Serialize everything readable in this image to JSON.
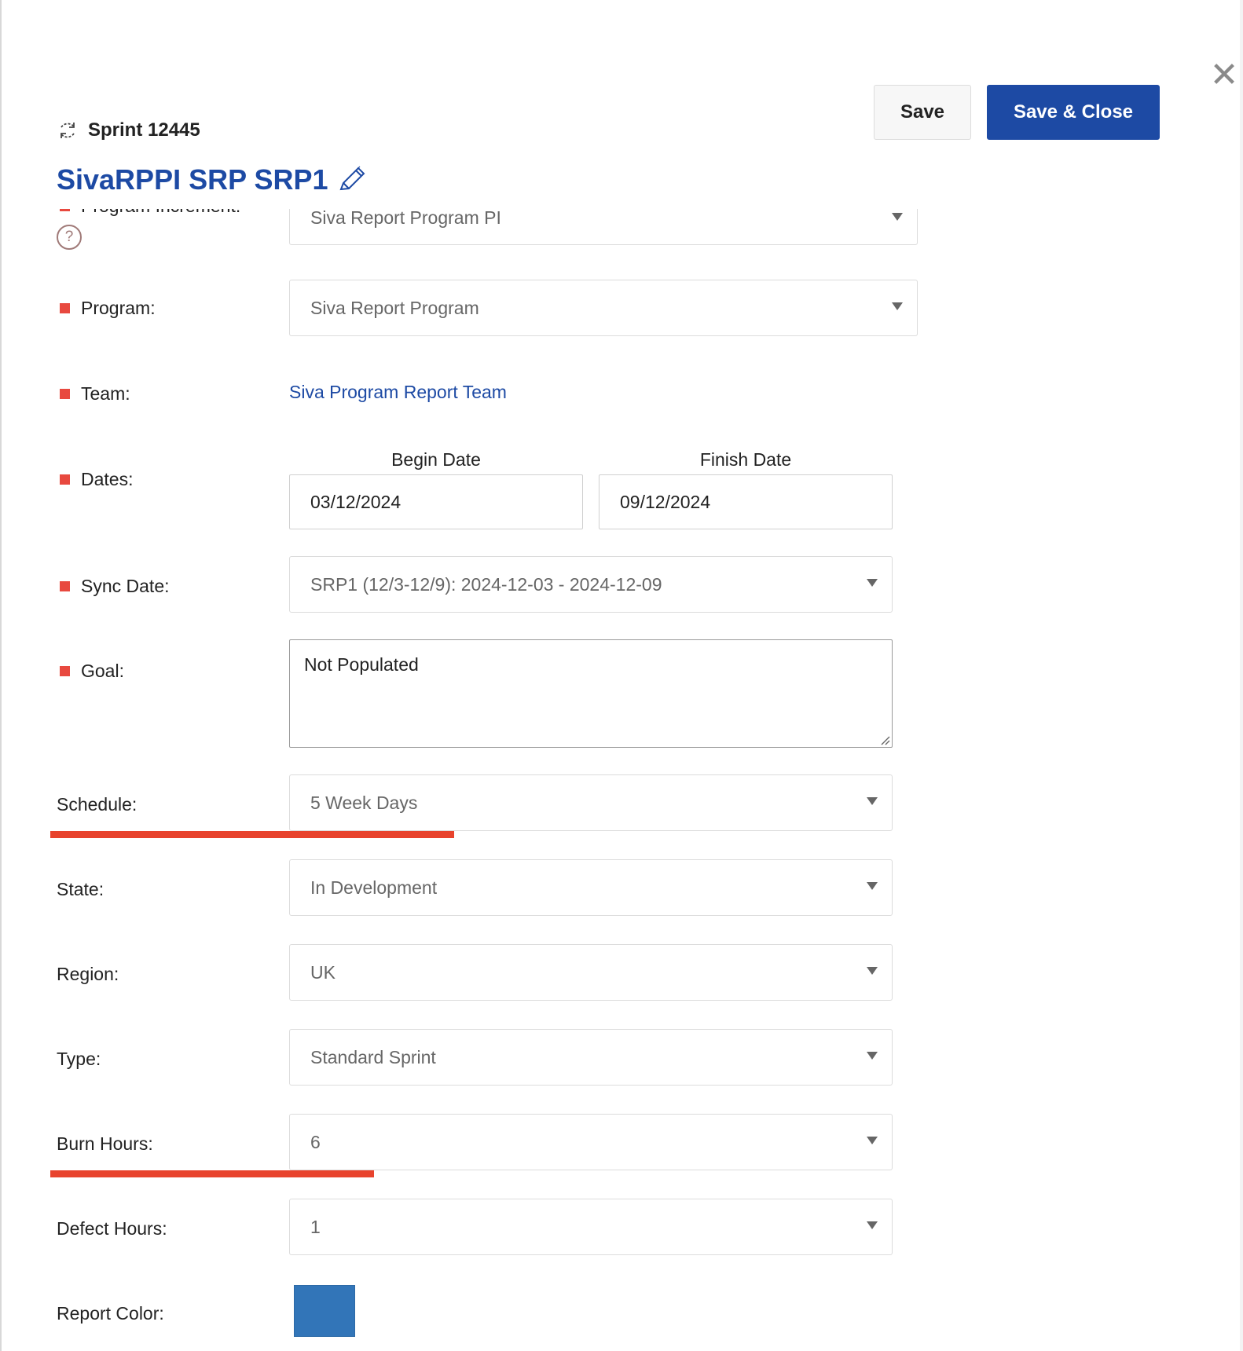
{
  "header": {
    "sprint_label": "Sprint 12445",
    "title": "SivaRPPI SRP SRP1",
    "save_label": "Save",
    "save_close_label": "Save & Close",
    "close_glyph": "✕"
  },
  "icons": {
    "sprint": "sync-icon",
    "edit": "pencil-icon",
    "close": "close-icon",
    "help": "help-icon"
  },
  "form": {
    "program_increment": {
      "label": "Program Increment:",
      "value": "Siva Report Program PI",
      "help": "?"
    },
    "program": {
      "label": "Program:",
      "value": "Siva Report Program"
    },
    "team": {
      "label": "Team:",
      "value": "Siva Program Report Team"
    },
    "dates": {
      "label": "Dates:",
      "begin_header": "Begin Date",
      "begin_value": "03/12/2024",
      "finish_header": "Finish Date",
      "finish_value": "09/12/2024"
    },
    "sync_date": {
      "label": "Sync Date:",
      "value": "SRP1 (12/3-12/9): 2024-12-03 - 2024-12-09"
    },
    "goal": {
      "label": "Goal:",
      "value": "Not Populated"
    },
    "schedule": {
      "label": "Schedule:",
      "value": "5 Week Days"
    },
    "state": {
      "label": "State:",
      "value": "In Development"
    },
    "region": {
      "label": "Region:",
      "value": "UK"
    },
    "type": {
      "label": "Type:",
      "value": "Standard Sprint"
    },
    "burn_hours": {
      "label": "Burn Hours:",
      "value": "6"
    },
    "defect_hours": {
      "label": "Defect Hours:",
      "value": "1"
    },
    "report_color": {
      "label": "Report Color:",
      "value": "#3275b8"
    }
  },
  "colors": {
    "accent": "#1d4aa4",
    "required": "#e8493f",
    "annotation_underline": "#e8432d"
  }
}
